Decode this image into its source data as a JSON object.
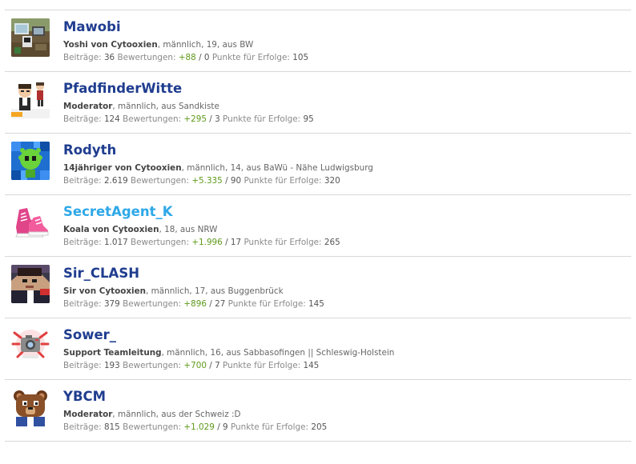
{
  "colors": {
    "username": "#1f3d8f",
    "username_highlight": "#2ea8e8",
    "positive": "#5f9a1b",
    "label": "#8a8a8a",
    "divider": "#d8d8d8"
  },
  "labels": {
    "posts": "Beiträge:",
    "ratings": "Bewertungen:",
    "ratings_separator": "/",
    "points": "Punkte für Erfolge:"
  },
  "members": [
    {
      "username": "Mawobi",
      "title": "Yoshi von Cytooxien",
      "details": ", männlich, 19, aus BW",
      "posts": "36",
      "ratings_positive": "+88",
      "ratings_negative": "0",
      "points": "105",
      "highlight": false,
      "avatar_icon": "minecraft-room-avatar-icon"
    },
    {
      "username": "PfadfinderWitte",
      "title": "Moderator",
      "details": ", männlich, aus Sandkiste",
      "posts": "124",
      "ratings_positive": "+295",
      "ratings_negative": "3",
      "points": "95",
      "highlight": false,
      "avatar_icon": "cartoon-characters-avatar-icon"
    },
    {
      "username": "Rodyth",
      "title": "14jähriger von Cytooxien",
      "details": ", männlich, 14, aus BaWü - Nähe Ludwigsburg",
      "posts": "2.619",
      "ratings_positive": "+5.335",
      "ratings_negative": "90",
      "points": "320",
      "highlight": false,
      "avatar_icon": "green-creature-avatar-icon"
    },
    {
      "username": "SecretAgent_K",
      "title": "Koala von Cytooxien",
      "details": ", 18, aus NRW",
      "posts": "1.017",
      "ratings_positive": "+1.996",
      "ratings_negative": "17",
      "points": "265",
      "highlight": true,
      "avatar_icon": "pink-sneakers-avatar-icon"
    },
    {
      "username": "Sir_CLASH",
      "title": "Sir von Cytooxien",
      "details": ", männlich, 17, aus Buggenbrück",
      "posts": "379",
      "ratings_positive": "+896",
      "ratings_negative": "27",
      "points": "145",
      "highlight": false,
      "avatar_icon": "pixel-character-avatar-icon"
    },
    {
      "username": "Sower_",
      "title": "Support Teamleitung",
      "details": ", männlich, 16, aus Sabbasofingen || Schleswig-Holstein",
      "posts": "193",
      "ratings_positive": "+700",
      "ratings_negative": "7",
      "points": "145",
      "highlight": false,
      "avatar_icon": "camera-avatar-icon"
    },
    {
      "username": "YBCM",
      "title": "Moderator",
      "details": ", männlich, aus der Schweiz :D",
      "posts": "815",
      "ratings_positive": "+1.029",
      "ratings_negative": "9",
      "points": "205",
      "highlight": false,
      "avatar_icon": "brown-bear-avatar-icon"
    }
  ]
}
